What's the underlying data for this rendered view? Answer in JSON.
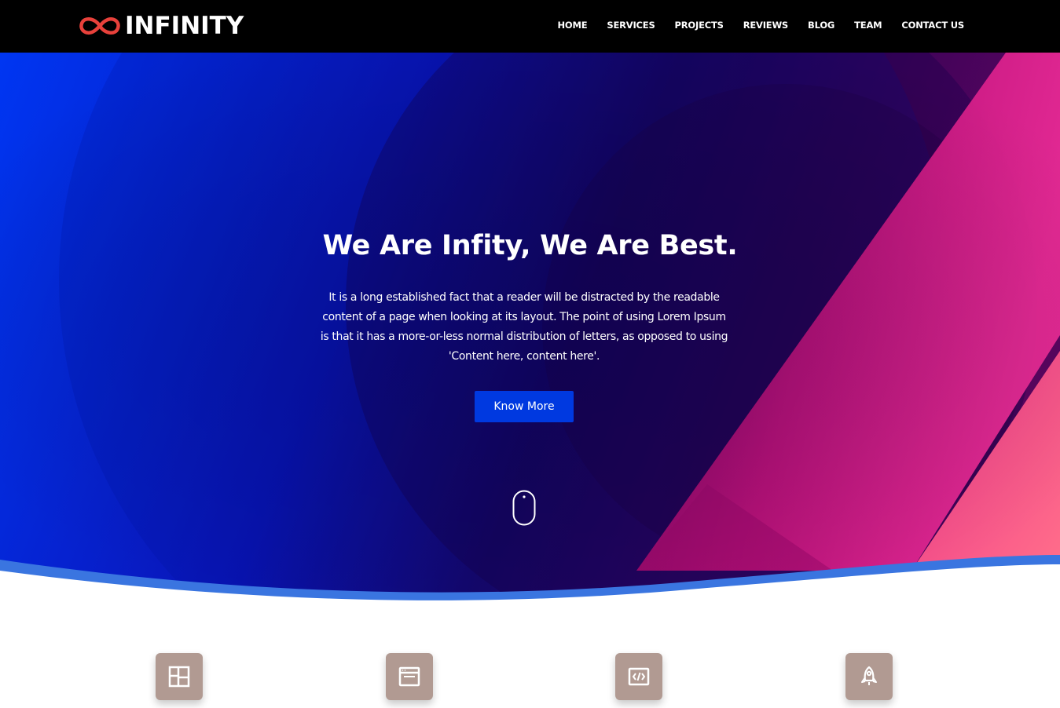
{
  "brand": {
    "name": "INFINITY",
    "logo_icon": "infinity-icon",
    "logo_color": "#e8413b"
  },
  "nav": {
    "items": [
      "HOME",
      "SERVICES",
      "PROJECTS",
      "REVIEWS",
      "BLOG",
      "TEAM",
      "CONTACT US"
    ]
  },
  "hero": {
    "title": "We Are Infity, We Are Best.",
    "text": "It is a long established fact that a reader will be distracted by the readable content of a page when looking at its layout. The point of using Lorem Ipsum is that it has a more-or-less normal distribution of letters, as opposed to using 'Content here, content here'.",
    "button_label": "Know More",
    "scroll_icon": "mouse-icon"
  },
  "features": {
    "icons": [
      "layout-icon",
      "browser-window-icon",
      "code-icon",
      "rocket-icon"
    ]
  },
  "colors": {
    "navbar_bg": "#000000",
    "hero_blue": "#0033ee",
    "hero_dark": "#1a0048",
    "hero_pink": "#e0208c",
    "wave_accent": "#3a75e0",
    "button_bg": "#0039e0",
    "feature_icon_bg": "#b19a92"
  }
}
